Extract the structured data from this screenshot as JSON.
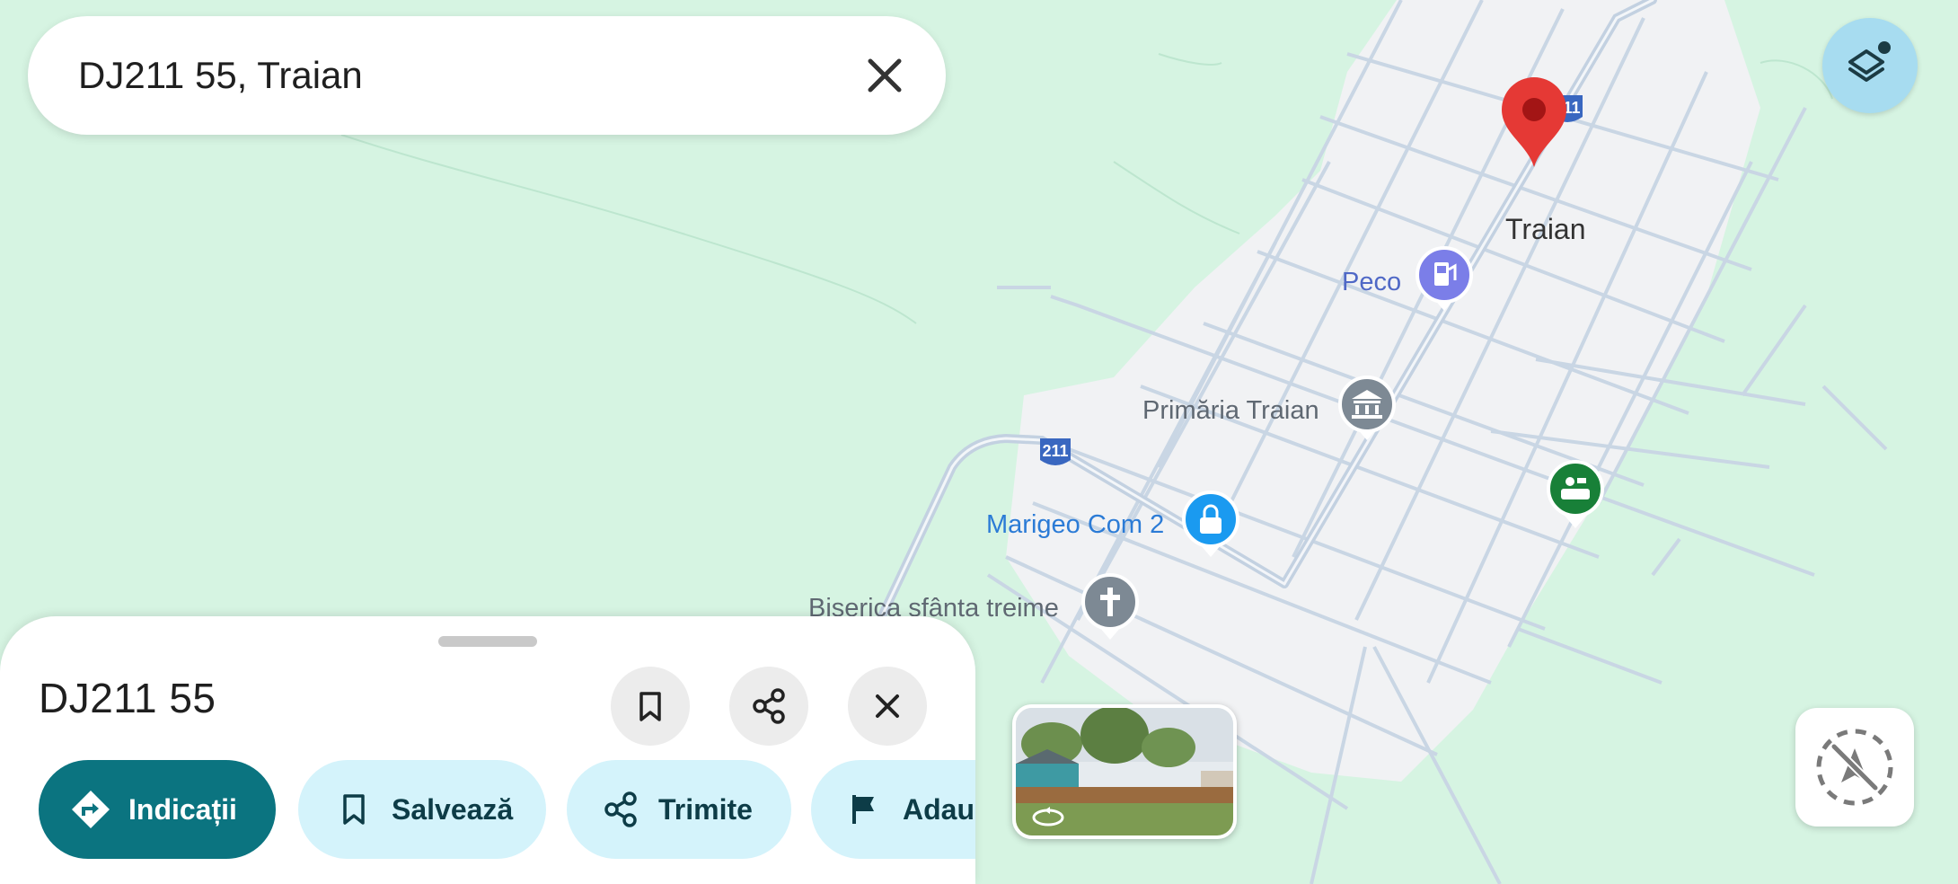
{
  "search": {
    "query": "DJ211 55, Traian"
  },
  "map": {
    "place_labels": [
      {
        "id": "town",
        "text": "Traian"
      },
      {
        "id": "peco",
        "text": "Peco"
      },
      {
        "id": "primaria",
        "text": "Primăria Traian"
      },
      {
        "id": "marigeo",
        "text": "Marigeo Com 2"
      },
      {
        "id": "biserica",
        "text": "Biserica sfânta treime"
      }
    ],
    "road_shields": [
      "211",
      "211"
    ],
    "colors": {
      "background": "#d6f4e2",
      "town_area": "#f1f2f4",
      "roads": "#c4d3e3",
      "pin": "#e53935",
      "gas": "#7b7ee8",
      "gov": "#7d8994",
      "shop": "#1a9af0",
      "church": "#7d8994",
      "park": "#188038"
    }
  },
  "sheet": {
    "title": "DJ211 55",
    "actions": {
      "directions": "Indicații",
      "save": "Salvează",
      "share": "Trimite",
      "add": "Adaug"
    },
    "icons": [
      "bookmark-icon",
      "share-icon",
      "close-icon"
    ]
  },
  "controls": {
    "layers_icon": "layers-icon",
    "location_icon": "location-disabled-icon"
  }
}
